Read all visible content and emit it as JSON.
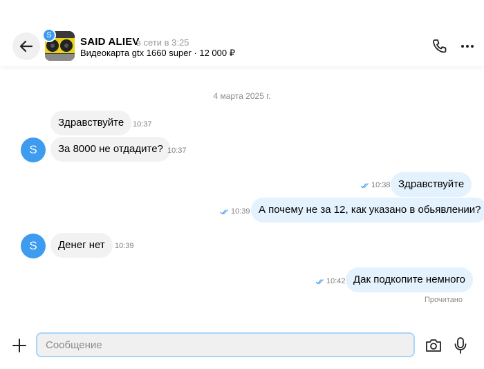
{
  "header": {
    "mini_avatar_letter": "S",
    "name": "SAID ALIEV",
    "status": "в сети в 3:25",
    "listing": "Видеокарта gtx 1660 super · 12 000 ₽"
  },
  "chat": {
    "date": "4 марта 2025 г.",
    "messages": [
      {
        "dir": "in",
        "text": "Здравствуйте",
        "time": "10:37"
      },
      {
        "dir": "in",
        "text": "За 8000 не отдадите?",
        "time": "10:37",
        "avatar": "S"
      },
      {
        "dir": "out",
        "text": "Здравствуйте",
        "time": "10:38"
      },
      {
        "dir": "out",
        "text": "А почему не за 12, как указано в обьявлении?",
        "time": "10:39"
      },
      {
        "dir": "in",
        "text": "Денег нет",
        "time": "10:39",
        "avatar": "S"
      },
      {
        "dir": "out",
        "text": "Дак подкопите немного",
        "time": "10:42"
      }
    ],
    "read_status": "Прочитано"
  },
  "composer": {
    "placeholder": "Сообщение",
    "value": ""
  },
  "colors": {
    "avatar": "#3d9bf0",
    "incoming_bubble": "#f2f2f2",
    "outgoing_bubble": "#e4f2fe",
    "read_ticks": "#3d9bf0",
    "input_border": "#a9d5fb"
  },
  "icons": {
    "back": "arrow-left-icon",
    "phone": "phone-icon",
    "more": "more-dots-icon",
    "add": "plus-icon",
    "camera": "camera-icon",
    "mic": "microphone-icon",
    "read": "double-check-icon"
  }
}
